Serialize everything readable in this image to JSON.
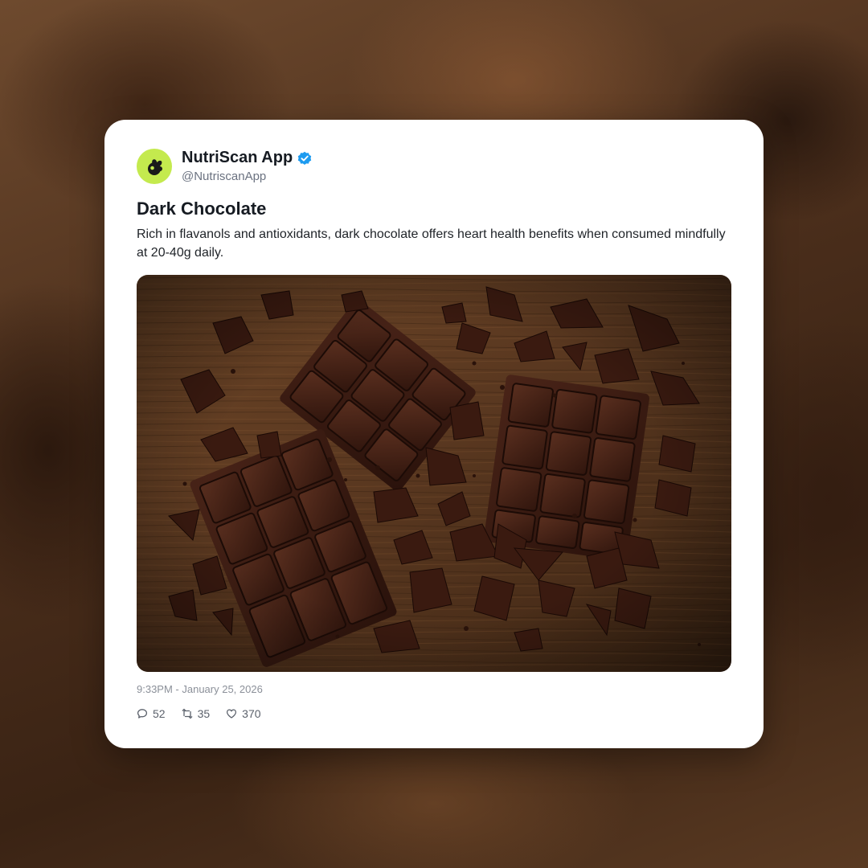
{
  "account": {
    "display_name": "NutriScan App",
    "handle": "@NutriscanApp",
    "verified": true,
    "avatar_color": "#c4ea4e",
    "verified_color": "#1d9bf0"
  },
  "post": {
    "title": "Dark Chocolate",
    "body": "Rich in flavanols and antioxidants, dark chocolate offers heart health benefits when consumed mindfully at 20-40g daily.",
    "timestamp": "9:33PM - January 25, 2026"
  },
  "engagement": {
    "replies": "52",
    "reposts": "35",
    "likes": "370"
  },
  "icons": {
    "avatar": "leaf-logo-icon",
    "verified": "verified-badge-icon",
    "replies": "comment-icon",
    "reposts": "repost-icon",
    "likes": "heart-icon"
  }
}
